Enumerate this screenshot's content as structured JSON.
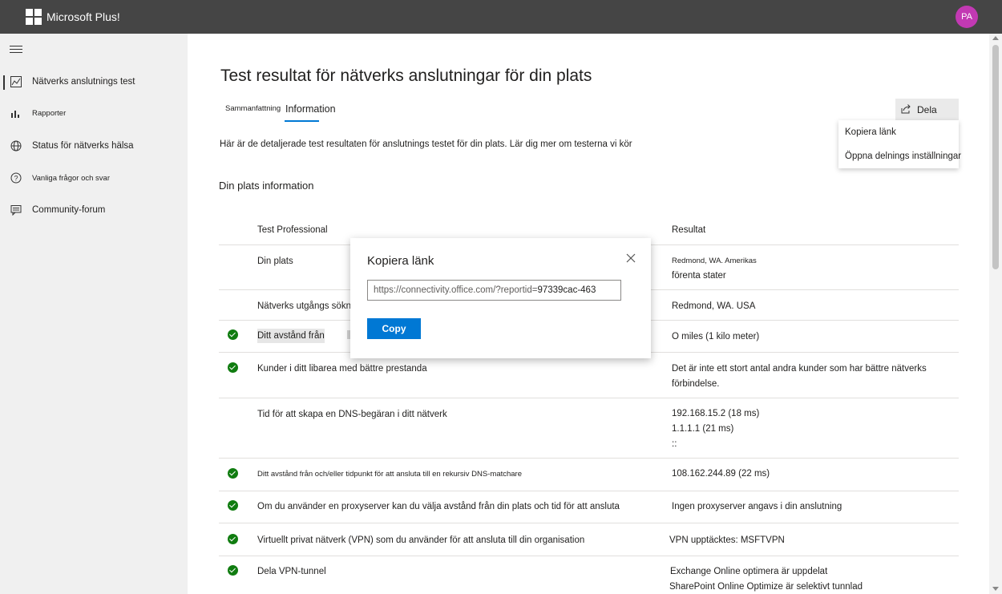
{
  "app": {
    "title": "Microsoft Plus!",
    "avatar_initials": "PA"
  },
  "sidebar": {
    "items": [
      {
        "label": "Nätverks anslutnings test",
        "icon": "chart-image-icon",
        "active": true
      },
      {
        "label": "Rapporter",
        "icon": "bar-chart-icon",
        "active": false
      },
      {
        "label": "Status för nätverks hälsa",
        "icon": "globe-icon",
        "active": false
      },
      {
        "label": "Vanliga frågor och svar",
        "icon": "help-circle-icon",
        "active": false
      },
      {
        "label": "Community-forum",
        "icon": "chat-icon",
        "active": false
      }
    ]
  },
  "page": {
    "title": "Test resultat för nätverks anslutningar för din plats",
    "tabs": [
      {
        "label": "Sammanfattning",
        "selected": false
      },
      {
        "label": "Information",
        "selected": true
      }
    ],
    "intro": "Här är de detaljerade test resultaten för anslutnings testet för din plats. Lär dig mer om testerna vi kör",
    "section_title": "Din plats information"
  },
  "share": {
    "label": "Dela",
    "menu": [
      "Kopiera länk",
      "Öppna delnings inställningar"
    ]
  },
  "table": {
    "headers": {
      "test": "Test Professional",
      "result": "Resultat"
    },
    "rows": [
      {
        "test": "Din plats",
        "result": [
          "Redmond, WA. Amerikas",
          "förenta stater"
        ],
        "check": false
      },
      {
        "test": "Nätverks utgångs sökning",
        "result": [
          "Redmond, WA. USA"
        ],
        "check": false
      },
      {
        "test": "Ditt avstånd från",
        "result": [
          "O miles (1 kilo meter)"
        ],
        "check": true
      },
      {
        "test": "Kunder i ditt libarea med bättre prestanda",
        "result": [
          "Det är inte ett stort antal andra kunder som har bättre nätverks",
          "förbindelse."
        ],
        "check": true
      },
      {
        "test": "Tid för att skapa en DNS-begäran i ditt nätverk",
        "result": [
          "192.168.15.2 (18 ms)",
          "1.1.1.1 (21 ms)",
          "::"
        ],
        "check": false
      },
      {
        "test": "Ditt avstånd från och/eller tidpunkt för att ansluta till en rekursiv DNS-matchare",
        "result": [
          "108.162.244.89 (22 ms)"
        ],
        "check": true
      },
      {
        "test": "Om du använder en proxyserver kan du välja avstånd från din plats och tid för att ansluta",
        "result": [
          "Ingen proxyserver angavs i din anslutning"
        ],
        "check": true
      },
      {
        "test": "Virtuellt privat nätverk (VPN) som du använder för att ansluta till din organisation",
        "result": [
          "VPN upptäcktes: MSFTVPN"
        ],
        "check": true
      },
      {
        "test": "Dela VPN-tunnel",
        "result": [
          "Exchange Online optimera är uppdelat",
          "SharePoint Online Optimize är selektivt tunnlad"
        ],
        "check": true
      }
    ]
  },
  "dialog": {
    "title": "Kopiera länk",
    "url_prefix": "https://connectivity.office.com/?reportid=",
    "url_id": "97339cac-463",
    "copy_label": "Copy"
  },
  "colors": {
    "accent": "#0078d4",
    "success": "#107c10",
    "topbar": "#454545",
    "avatar": "#c239b3"
  }
}
